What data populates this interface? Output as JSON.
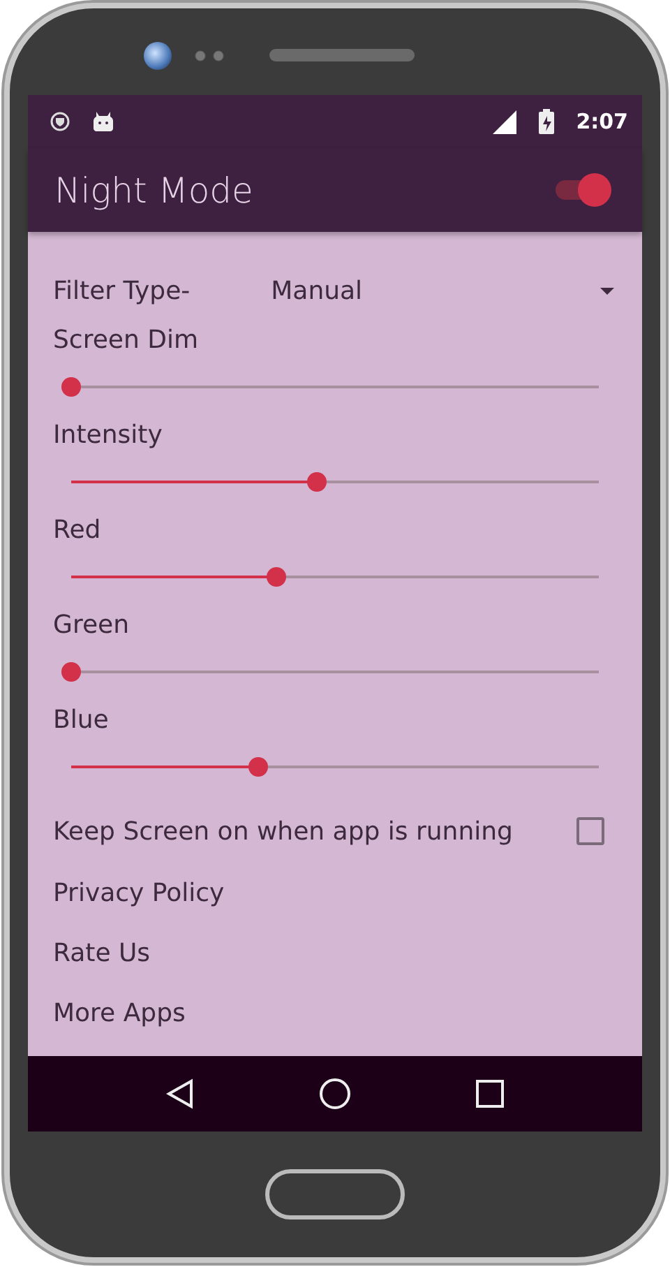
{
  "status_bar": {
    "time": "2:07"
  },
  "toolbar": {
    "title": "Night Mode",
    "on": true
  },
  "filter": {
    "label": "Filter Type-",
    "value": "Manual"
  },
  "sliders": [
    {
      "label": "Screen Dim",
      "level": 0
    },
    {
      "label": "Intensity",
      "level": 0.466
    },
    {
      "label": "Red",
      "level": 0.39
    },
    {
      "label": "Green",
      "level": 0
    },
    {
      "label": "Blue",
      "level": 0.355
    }
  ],
  "keep_screen": {
    "label": "Keep Screen on when app is running",
    "checked": false
  },
  "links": [
    "Privacy Policy",
    "Rate Us",
    "More Apps"
  ]
}
